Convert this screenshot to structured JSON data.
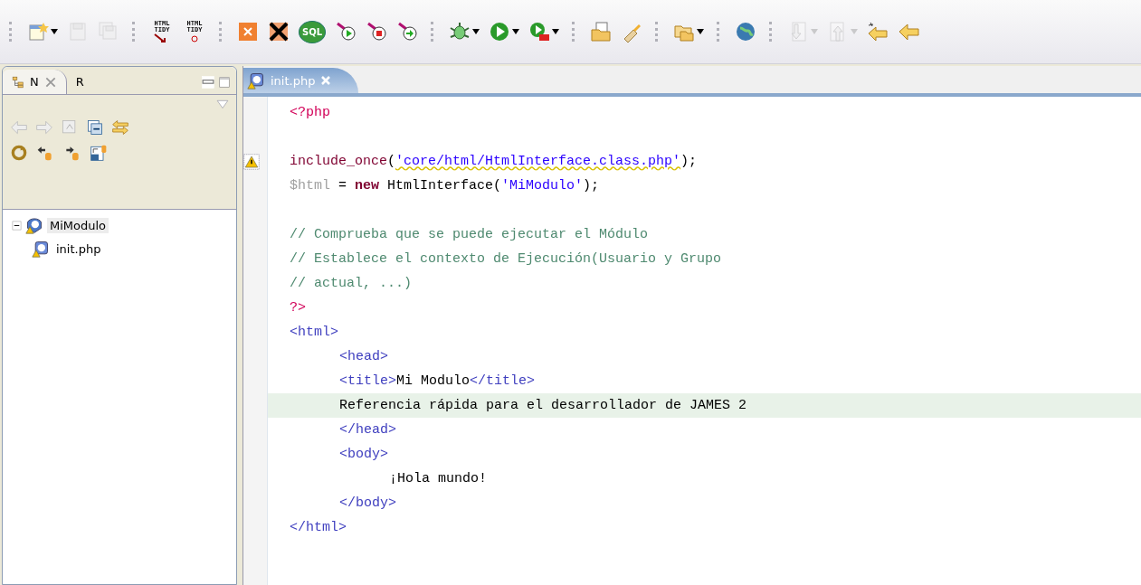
{
  "toolbar": {
    "groups": [
      [
        {
          "kind": "new",
          "dropdown": true
        },
        {
          "kind": "save",
          "disabled": true
        },
        {
          "kind": "save-all",
          "disabled": true
        }
      ],
      [
        {
          "kind": "tidy",
          "label": "HTML TIDY"
        },
        {
          "kind": "tidy-help",
          "label": "HTML TIDY"
        }
      ],
      [
        {
          "kind": "xampp"
        },
        {
          "kind": "xampp-stop"
        },
        {
          "kind": "sql",
          "label": "SQL"
        },
        {
          "kind": "run-pin"
        },
        {
          "kind": "stop-pin"
        },
        {
          "kind": "go-pin"
        }
      ],
      [
        {
          "kind": "bug",
          "dropdown": true
        },
        {
          "kind": "run",
          "dropdown": true
        },
        {
          "kind": "run-tool",
          "dropdown": true
        }
      ],
      [
        {
          "kind": "open-file"
        },
        {
          "kind": "brush"
        }
      ],
      [
        {
          "kind": "folders",
          "dropdown": true
        }
      ],
      [
        {
          "kind": "globe"
        }
      ],
      [
        {
          "kind": "down",
          "dropdown": true,
          "disabled": true
        },
        {
          "kind": "up",
          "dropdown": true,
          "disabled": true
        },
        {
          "kind": "back-star"
        },
        {
          "kind": "back"
        }
      ]
    ]
  },
  "side_panel": {
    "tabs": [
      {
        "label": "N",
        "selected": true
      },
      {
        "label": "R",
        "selected": false
      }
    ],
    "tree": [
      {
        "label": "MiModulo",
        "kind": "project",
        "expanded": true,
        "warning": true,
        "children": [
          {
            "label": "init.php",
            "kind": "file",
            "warning": true
          }
        ]
      }
    ]
  },
  "editor": {
    "tabs": [
      {
        "label": "init.php",
        "selected": true,
        "warning": true
      }
    ],
    "lines": [
      {
        "kind": "code",
        "tokens": [
          {
            "text": "<?php",
            "kind": "php"
          }
        ]
      },
      {
        "kind": "blank"
      },
      {
        "kind": "code",
        "warning": true,
        "tokens": [
          {
            "text": "include_once",
            "kind": "fn"
          },
          {
            "text": "(",
            "kind": "plain"
          },
          {
            "text": "'core/html/HtmlInterface.class.php'",
            "kind": "string",
            "squiggle": true
          },
          {
            "text": ");",
            "kind": "plain"
          }
        ]
      },
      {
        "kind": "code",
        "tokens": [
          {
            "text": "$html",
            "kind": "var"
          },
          {
            "text": " = ",
            "kind": "plain"
          },
          {
            "text": "new",
            "kind": "keyword"
          },
          {
            "text": " HtmlInterface(",
            "kind": "plain"
          },
          {
            "text": "'MiModulo'",
            "kind": "string"
          },
          {
            "text": ");",
            "kind": "plain"
          }
        ]
      },
      {
        "kind": "blank"
      },
      {
        "kind": "code",
        "tokens": [
          {
            "text": "// Comprueba que se puede ejecutar el Módulo",
            "kind": "comment"
          }
        ]
      },
      {
        "kind": "code",
        "tokens": [
          {
            "text": "// Establece el contexto de Ejecución(Usuario y Grupo",
            "kind": "comment"
          }
        ]
      },
      {
        "kind": "code",
        "tokens": [
          {
            "text": "// actual, ...)",
            "kind": "comment"
          }
        ]
      },
      {
        "kind": "code",
        "tokens": [
          {
            "text": "?>",
            "kind": "php"
          }
        ]
      },
      {
        "kind": "code",
        "tokens": [
          {
            "text": "<html>",
            "kind": "tag"
          }
        ],
        "children": [
          {
            "kind": "code",
            "tokens": [
              {
                "text": "<head>",
                "kind": "tag"
              }
            ]
          },
          {
            "kind": "code",
            "tokens": [
              {
                "text": "<title>",
                "kind": "tag"
              },
              {
                "text": "Mi Modulo",
                "kind": "plain"
              },
              {
                "text": "</title>",
                "kind": "tag"
              }
            ]
          },
          {
            "kind": "code",
            "current": true,
            "tokens": [
              {
                "text": "Referencia rápida para el desarrollador de JAMES 2",
                "kind": "plain"
              }
            ]
          },
          {
            "kind": "code",
            "tokens": [
              {
                "text": "</head>",
                "kind": "tag"
              }
            ]
          },
          {
            "kind": "code",
            "tokens": [
              {
                "text": "<body>",
                "kind": "tag"
              }
            ],
            "children": [
              {
                "kind": "code",
                "tokens": [
                  {
                    "text": "¡Hola mundo!",
                    "kind": "plain"
                  }
                ]
              }
            ]
          },
          {
            "kind": "code",
            "tokens": [
              {
                "text": "</body>",
                "kind": "tag"
              }
            ]
          }
        ]
      },
      {
        "kind": "code",
        "tokens": [
          {
            "text": "</html>",
            "kind": "tag"
          }
        ]
      }
    ]
  }
}
